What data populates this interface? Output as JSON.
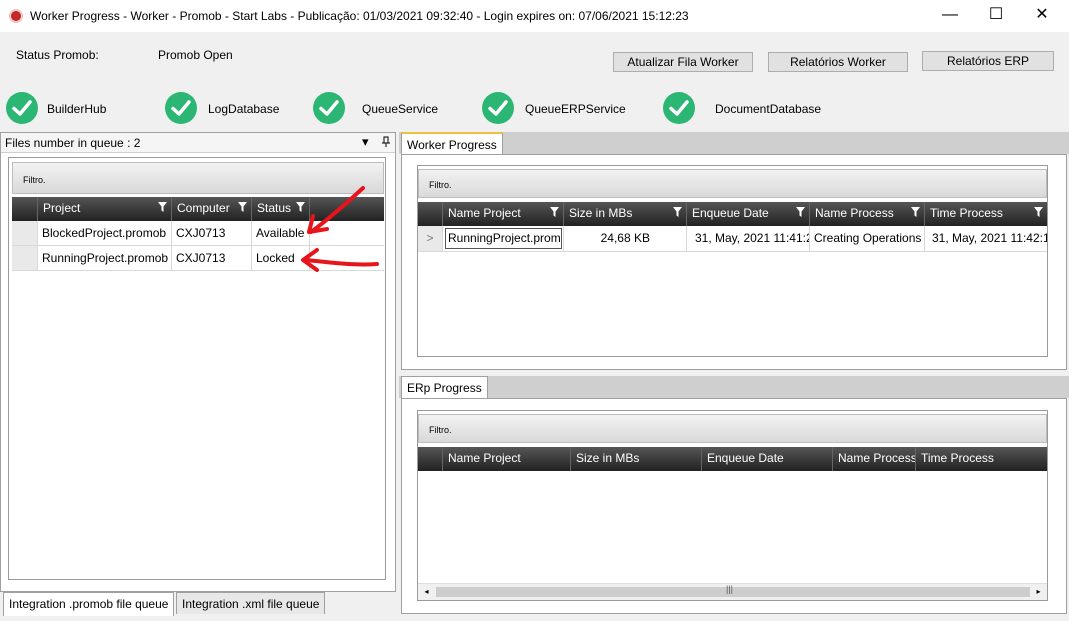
{
  "window": {
    "title": "Worker Progress  -  Worker - Promob  -  Start Labs  -  Publicação: 01/03/2021 09:32:40 - Login expires on: 07/06/2021 15:12:23",
    "minimize": "—",
    "maximize": "☐",
    "close": "✕"
  },
  "status": {
    "label": "Status Promob:",
    "value": "Promob Open"
  },
  "toolbar": {
    "update_queue": "Atualizar Fila Worker",
    "worker_reports": "Relatórios Worker",
    "erp_reports": "Relatórios ERP"
  },
  "services": [
    {
      "name": "BuilderHub",
      "icon": "check-circle-icon",
      "color": "#2bb673"
    },
    {
      "name": "LogDatabase",
      "icon": "check-circle-icon",
      "color": "#2bb673"
    },
    {
      "name": "QueueService",
      "icon": "check-circle-icon",
      "color": "#2bb673"
    },
    {
      "name": "QueueERPService",
      "icon": "check-circle-icon",
      "color": "#2bb673"
    },
    {
      "name": "DocumentDatabase",
      "icon": "check-circle-icon",
      "color": "#2bb673"
    }
  ],
  "queue_panel": {
    "title": "Files number in queue : 2",
    "dropdown_icon": "▾",
    "pin_icon": "pin-icon",
    "filter_label": "Filtro.",
    "columns": [
      "Project",
      "Computer",
      "Status"
    ],
    "rows": [
      {
        "project": "BlockedProject.promob",
        "computer": "CXJ0713",
        "status": "Available"
      },
      {
        "project": "RunningProject.promob",
        "computer": "CXJ0713",
        "status": "Locked"
      }
    ],
    "tabs": [
      "Integration .promob file queue",
      "Integration .xml file queue"
    ],
    "annotation_color": "#e8141c"
  },
  "worker_progress": {
    "tab": "Worker Progress",
    "filter_label": "Filtro.",
    "columns": [
      "Name Project",
      "Size in MBs",
      "Enqueue Date",
      "Name Process",
      "Time Process"
    ],
    "rows": [
      {
        "name_project": "RunningProject.promob",
        "size": "24,68 KB",
        "enqueue_date": "31, May, 2021 11:41:2",
        "name_process": "Creating Operations",
        "time_process": "31, May, 2021 11:42:1"
      }
    ],
    "row_indicator": ">"
  },
  "erp_progress": {
    "tab": "ERp Progress",
    "filter_label": "Filtro.",
    "columns": [
      "Name Project",
      "Size in MBs",
      "Enqueue Date",
      "Name Process",
      "Time Process"
    ],
    "scroll_left": "◂",
    "scroll_right": "▸",
    "scroll_thumb": "|||"
  }
}
